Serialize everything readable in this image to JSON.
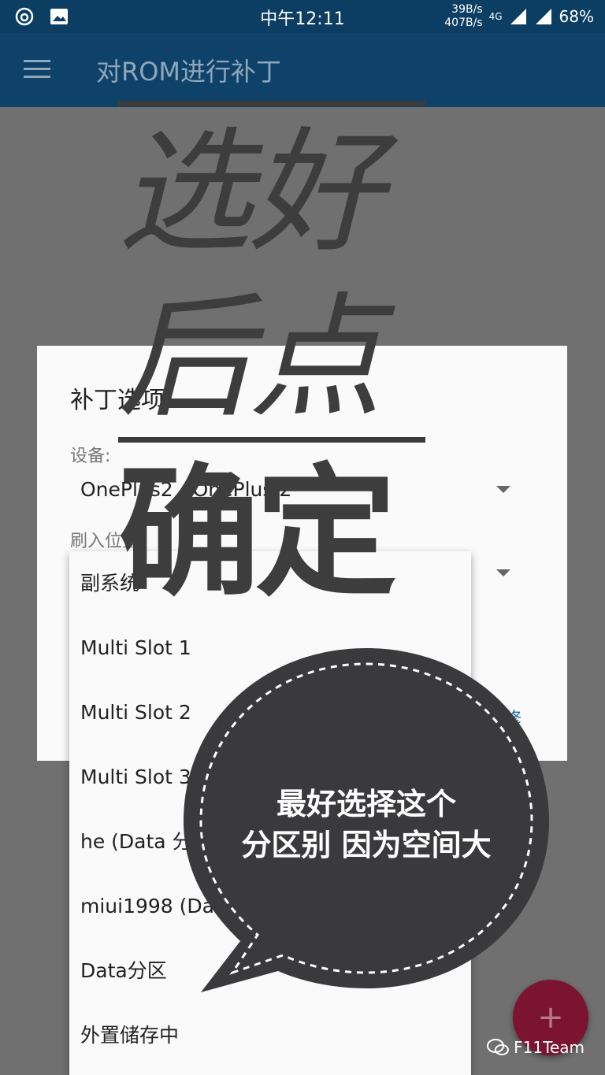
{
  "status_bar": {
    "time": "中午12:11",
    "speed_up": "39B/s",
    "speed_down": "407B/s",
    "network": "4G",
    "battery": "68%"
  },
  "appbar": {
    "title": "对ROM进行补丁"
  },
  "dialog": {
    "title": "补丁选项",
    "device_label": "设备:",
    "device_value": "OnePlus2 - OnePlus 2",
    "flash_label": "刷入位置:",
    "action_text": "修"
  },
  "dropdown": {
    "items": [
      "副系统",
      "Multi Slot 1",
      "Multi Slot 2",
      "Multi Slot 3",
      "he (Data 分区)",
      "miui1998 (Data 分区)",
      "Data分区",
      "外置储存中"
    ]
  },
  "overlay": {
    "line1": "选好",
    "line2": "后点",
    "line3": "确定",
    "bubble_line1": "最好选择这个",
    "bubble_line2": "分区别  因为空间大"
  },
  "fab": {
    "label": "+"
  },
  "watermark": {
    "text": "F11Team"
  }
}
